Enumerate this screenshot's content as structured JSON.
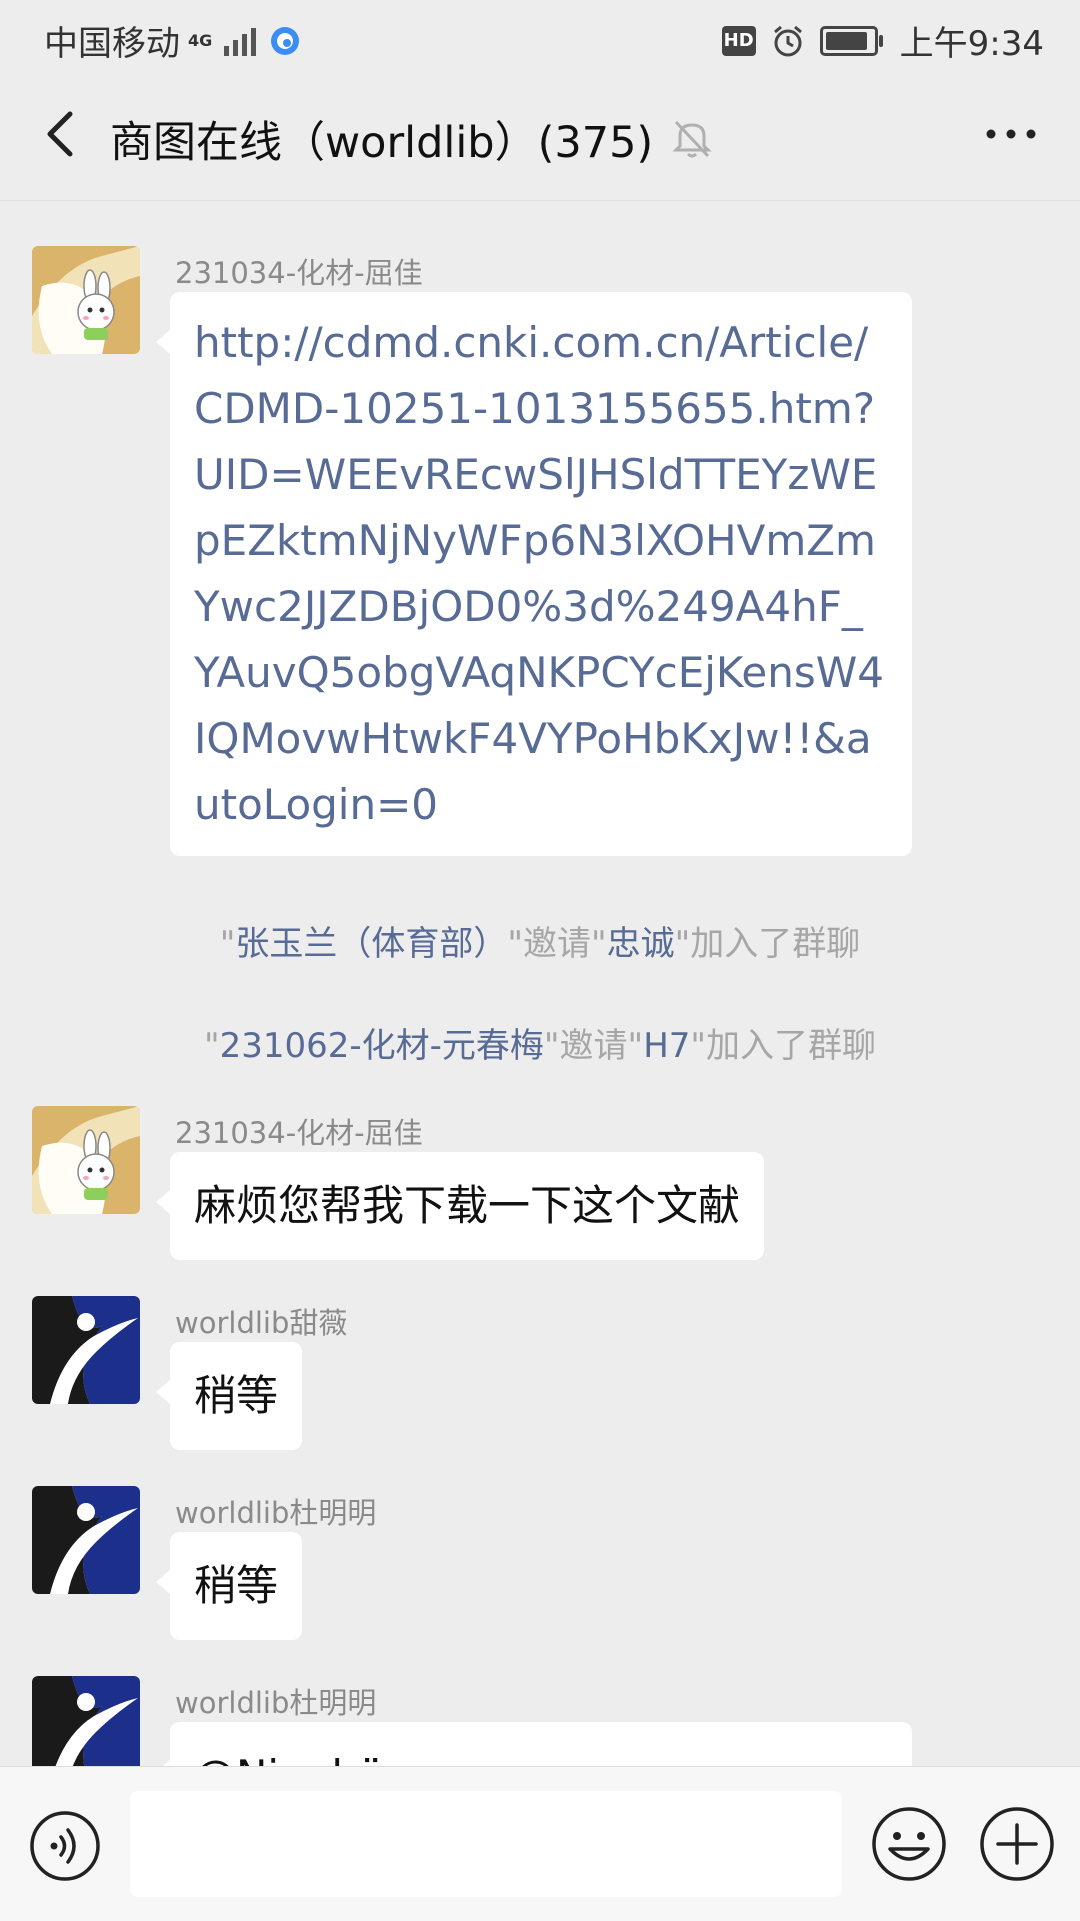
{
  "status_bar": {
    "carrier": "中国移动",
    "network": "4G",
    "hd": "HD",
    "time": "上午9:34"
  },
  "nav": {
    "title": "商图在线（worldlib）(375)"
  },
  "messages": {
    "m1": {
      "sender": "231034-化材-屈佳",
      "text": "http://cdmd.cnki.com.cn/Article/CDMD-10251-1013155655.htm?UID=WEEvREcwSlJHSldTTEYzWEpEZktmNjNyWFp6N3lXOHVmZmYwc2JJZDBjOD0%3d%249A4hF_YAuvQ5obgVAqNKPCYcEjKensW4IQMovwHtwkF4VYPoHbKxJw!!&autoLogin=0"
    },
    "sys1": {
      "q1": "\"",
      "inviter": "张玉兰（体育部）",
      "mid": "\"邀请\"",
      "invitee": "忠诚",
      "end": "\"加入了群聊"
    },
    "sys2": {
      "q1": "\"",
      "inviter": "231062-化材-元春梅",
      "mid": "\"邀请\"",
      "invitee": "H7",
      "end": "\"加入了群聊"
    },
    "m2": {
      "sender": "231034-化材-屈佳",
      "text": "麻烦您帮我下载一下这个文献"
    },
    "m3": {
      "sender": "worldlib甜薇",
      "text": "稍等"
    },
    "m4": {
      "sender": "worldlib杜明明",
      "text": "稍等"
    },
    "m5": {
      "sender": "worldlib杜明明",
      "text": "@Nianhü..."
    }
  },
  "input": {
    "value": "",
    "placeholder": ""
  },
  "icons": {
    "back": "chevron-left-icon",
    "mute": "bell-off-icon",
    "more": "more-dots-icon",
    "voice": "voice-icon",
    "emoji": "emoji-icon",
    "plus": "plus-icon",
    "alarm": "alarm-icon",
    "signal": "signal-icon",
    "battery": "battery-icon"
  },
  "colors": {
    "link": "#576b95",
    "background": "#ededed",
    "bubble": "#ffffff",
    "avatar_blue": "#1c2f8a"
  }
}
